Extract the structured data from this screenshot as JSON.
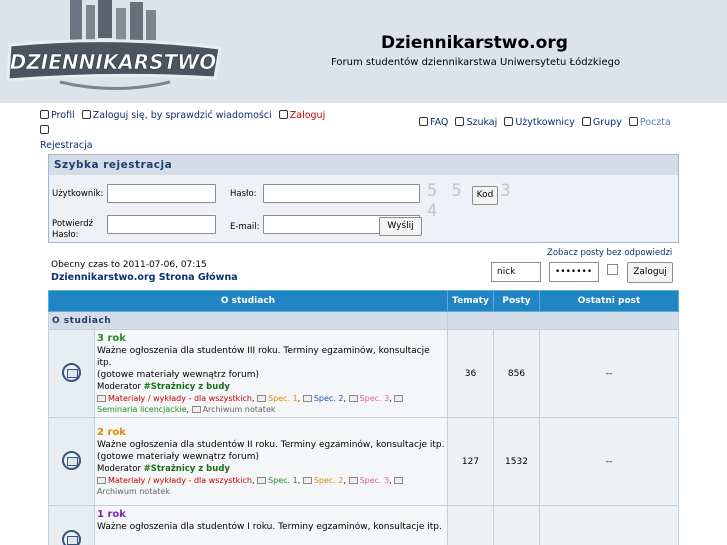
{
  "header": {
    "logo_text": "DZIENNIKARSTWO",
    "title": "Dziennikarstwo.org",
    "description": "Forum studentów dziennikarstwa Uniwersytetu Łódzkiego"
  },
  "nav": {
    "left": [
      {
        "label": "Profil",
        "icon": "profile-icon",
        "color": "#0b2e74"
      },
      {
        "label": "Zaloguj się, by sprawdzić wiadomości",
        "icon": "messages-icon",
        "color": "#0b2e74"
      },
      {
        "label": "Zaloguj",
        "icon": "login-icon",
        "color": "#c40000"
      },
      {
        "label": "Rejestracja",
        "icon": "register-icon",
        "color": "#0b2e74"
      }
    ],
    "right": [
      {
        "label": "FAQ",
        "icon": "faq-icon"
      },
      {
        "label": "Szukaj",
        "icon": "search-icon"
      },
      {
        "label": "Użytkownicy",
        "icon": "users-icon"
      },
      {
        "label": "Grupy",
        "icon": "groups-icon"
      },
      {
        "label": "Poczta",
        "icon": "mail-icon"
      }
    ]
  },
  "quick_register": {
    "title": "Szybka rejestracja",
    "username_label": "Użytkownik:",
    "password_label": "Hasło:",
    "confirm_label_1": "Potwierdź",
    "confirm_label_2": "Hasło:",
    "email_label": "E-mail:",
    "captcha": "5 5 . 3 4",
    "code_button": "Kod",
    "submit_button": "Wyślij"
  },
  "info": {
    "current_time": "Obecny czas to 2011-07-06, 07:15",
    "home_link": "Dziennikarstwo.org Strona Główna",
    "unanswered_link": "Zobacz posty bez odpowiedzi"
  },
  "login": {
    "username_value": "nick",
    "password_value": "•••••••",
    "button": "Zaloguj"
  },
  "forum_table": {
    "headers": [
      "O studiach",
      "Tematy",
      "Posty",
      "Ostatni post"
    ],
    "category": "O studiach",
    "forums": [
      {
        "name": "3 rok",
        "name_color": "#2a8a2a",
        "desc_1": "Ważne ogłoszenia dla studentów III roku. Terminy egzaminów, konsultacje itp.",
        "desc_2": "(gotowe materiały wewnątrz forum)",
        "mod_label": "Moderator",
        "mod_name": "#Strażnicy z budy",
        "subforums": [
          {
            "label": "Materiały / wykłady - dla wszystkich",
            "color": "#c40000"
          },
          {
            "label": "Spec. 1",
            "color": "#e08a00"
          },
          {
            "label": "Spec. 2",
            "color": "#1a55c0"
          },
          {
            "label": "Spec. 3",
            "color": "#e060a0"
          },
          {
            "label": "Seminaria licencjackie",
            "color": "#2a8a2a"
          },
          {
            "label": "Archiwum notatek",
            "color": "#666666"
          }
        ],
        "topics": "36",
        "posts": "856",
        "last_post": "--"
      },
      {
        "name": "2 rok",
        "name_color": "#e08a00",
        "desc_1": "Ważne ogłoszenia dla studentów II roku. Terminy egzaminów, konsultacje itp.",
        "desc_2": "(gotowe materiały wewnątrz forum)",
        "mod_label": "Moderator",
        "mod_name": "#Strażnicy z budy",
        "subforums": [
          {
            "label": "Materiały / wykłady - dla wszystkich",
            "color": "#c40000"
          },
          {
            "label": "Spec. 1",
            "color": "#2a8a2a"
          },
          {
            "label": "Spec. 2",
            "color": "#e08a00"
          },
          {
            "label": "Spec. 3",
            "color": "#e060a0"
          },
          {
            "label": "Archiwum notatek",
            "color": "#666666"
          }
        ],
        "topics": "127",
        "posts": "1532",
        "last_post": "--"
      },
      {
        "name": "1 rok",
        "name_color": "#7a2ab0",
        "desc_1": "Ważne ogłoszenia dla studentów I roku. Terminy egzaminów, konsultacje itp.",
        "desc_2": "",
        "mod_label": "",
        "mod_name": "",
        "subforums": [],
        "topics": "",
        "posts": "",
        "last_post": ""
      }
    ]
  }
}
